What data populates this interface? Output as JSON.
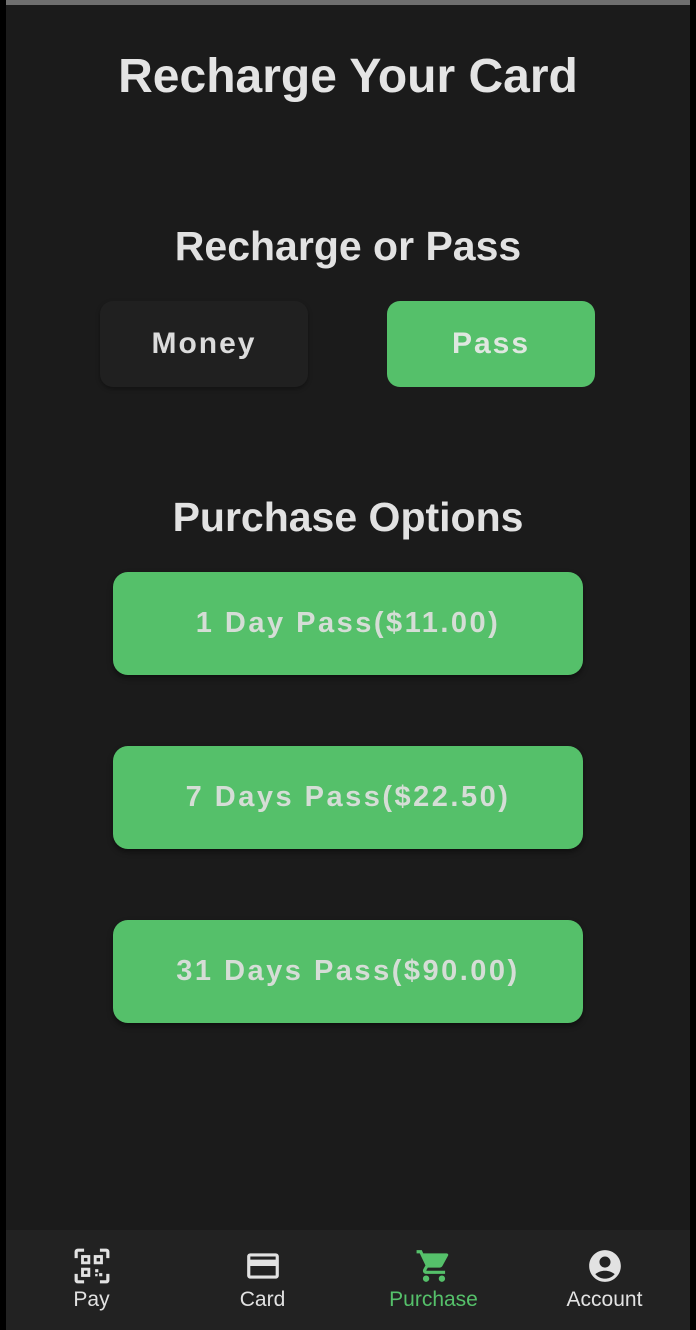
{
  "page": {
    "title": "Recharge Your Card"
  },
  "recharge": {
    "heading": "Recharge or Pass",
    "money_label": "Money",
    "pass_label": "Pass",
    "selected": "Pass"
  },
  "purchase": {
    "heading": "Purchase Options",
    "options": [
      {
        "label": "1 Day Pass($11.00)"
      },
      {
        "label": "7 Days Pass($22.50)"
      },
      {
        "label": "31 Days Pass($90.00)"
      }
    ]
  },
  "nav": {
    "active": "Purchase",
    "items": [
      {
        "label": "Pay",
        "icon": "qr-code-icon"
      },
      {
        "label": "Card",
        "icon": "credit-card-icon"
      },
      {
        "label": "Purchase",
        "icon": "cart-icon"
      },
      {
        "label": "Account",
        "icon": "account-circle-icon"
      }
    ]
  },
  "colors": {
    "background": "#1b1b1b",
    "accent": "#55c06a",
    "text": "#e2e2e2",
    "nav_background": "#222222"
  }
}
